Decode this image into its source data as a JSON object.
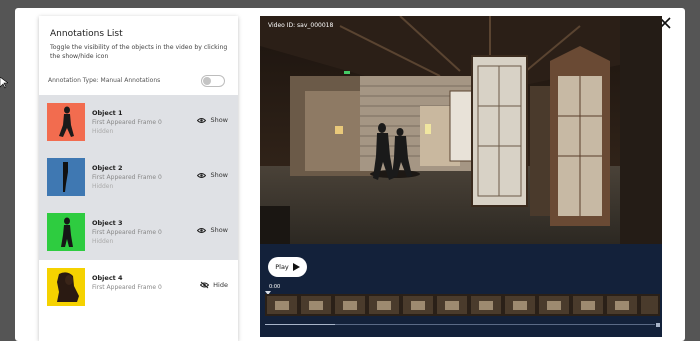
{
  "panel": {
    "title": "Annotations List",
    "description": "Toggle the visibility of the objects in the video by clicking the show/hide icon",
    "annotation_type_label": "Annotation Type: Manual Annotations",
    "toggle_on": false
  },
  "objects": [
    {
      "name": "Object 1",
      "first_frame": "First Appeared Frame 0",
      "status": "Hidden",
      "action": "Show",
      "color": "#f26c4f"
    },
    {
      "name": "Object 2",
      "first_frame": "First Appeared Frame 0",
      "status": "Hidden",
      "action": "Show",
      "color": "#3f78b2"
    },
    {
      "name": "Object 3",
      "first_frame": "First Appeared Frame 0",
      "status": "Hidden",
      "action": "Show",
      "color": "#2ecc40"
    },
    {
      "name": "Object 4",
      "first_frame": "First Appeared Frame 0",
      "status": "",
      "action": "Hide",
      "color": "#f5d200"
    }
  ],
  "video": {
    "id_label": "Video ID: sav_000018",
    "play_label": "Play",
    "timecode": "0:00",
    "progress": 0.18
  },
  "icons": {
    "close": "close-icon",
    "show": "eye-icon",
    "hide": "eye-slash-icon",
    "play": "play-icon"
  }
}
